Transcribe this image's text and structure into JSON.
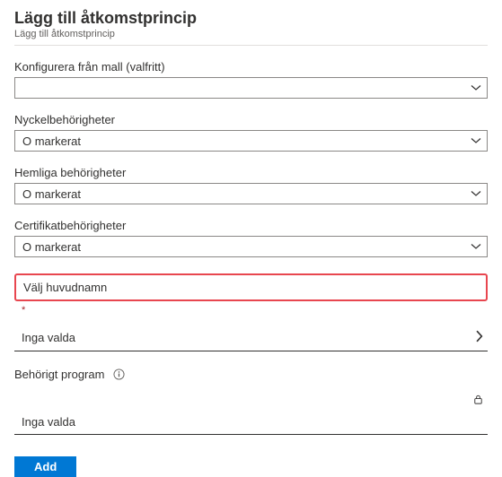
{
  "header": {
    "title": "Lägg till åtkomstprincip",
    "subtitle": "Lägg till åtkomstprincip"
  },
  "fields": {
    "template": {
      "label": "Konfigurera från mall (valfritt)",
      "value": ""
    },
    "key_permissions": {
      "label": "Nyckelbehörigheter",
      "value": "O markerat"
    },
    "secret_permissions": {
      "label": "Hemliga behörigheter",
      "value": "O markerat"
    },
    "certificate_permissions": {
      "label": "Certifikatbehörigheter",
      "value": "O markerat"
    }
  },
  "principal": {
    "section_label": "Välj huvudnamn",
    "required_mark": "*",
    "none_selected": "Inga valda"
  },
  "application": {
    "label": "Behörigt program",
    "none_selected": "Inga valda"
  },
  "buttons": {
    "add": "Add"
  }
}
